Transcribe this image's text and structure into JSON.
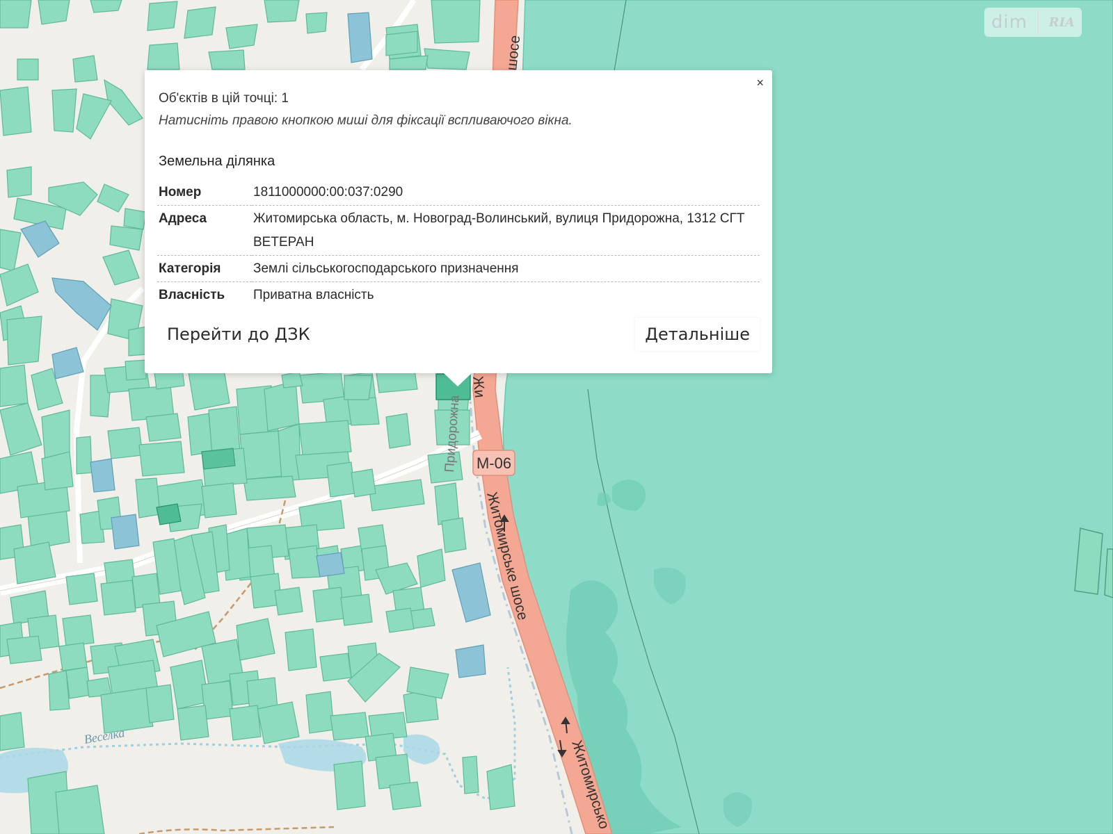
{
  "map": {
    "road_labels": {
      "shose_top": "шосе",
      "zhyt_popup": "Жи",
      "pryd": "Придорожна",
      "m06": "М-06",
      "zhyt_shose_mid": "Житомирське шосе",
      "zhyt_bottom": "Житомирсько",
      "veselka": "Веселка"
    },
    "colors": {
      "background": "#f1efe9",
      "parcel": "#8ddcc0",
      "parcel_stroke": "#5fb999",
      "parcel_blue": "#8cc3d6",
      "forest": "#8edcc7",
      "road": "#f4a893",
      "road_stroke": "#e08f7b",
      "water": "#a8d8e6"
    }
  },
  "watermark": {
    "dim": "dim",
    "ria": "RIA"
  },
  "popup": {
    "close": "×",
    "count_text": "Об'єктів в цій точці: 1",
    "hint_text": "Натисніть правою кнопкою миші для фіксації вспливаючого вікна.",
    "section_title": "Земельна ділянка",
    "rows": [
      {
        "key": "Номер",
        "value": "1811000000:00:037:0290"
      },
      {
        "key": "Адреса",
        "value": "Житомирська область, м. Новоград-Волинський, вулиця Придорожна, 1312 СГТ ВЕТЕРАН"
      },
      {
        "key": "Категорія",
        "value": "Землі сільськогосподарського призначення"
      },
      {
        "key": "Власність",
        "value": "Приватна власність"
      }
    ],
    "btn_dzk": "Перейти до ДЗК",
    "btn_details": "Детальніше"
  }
}
